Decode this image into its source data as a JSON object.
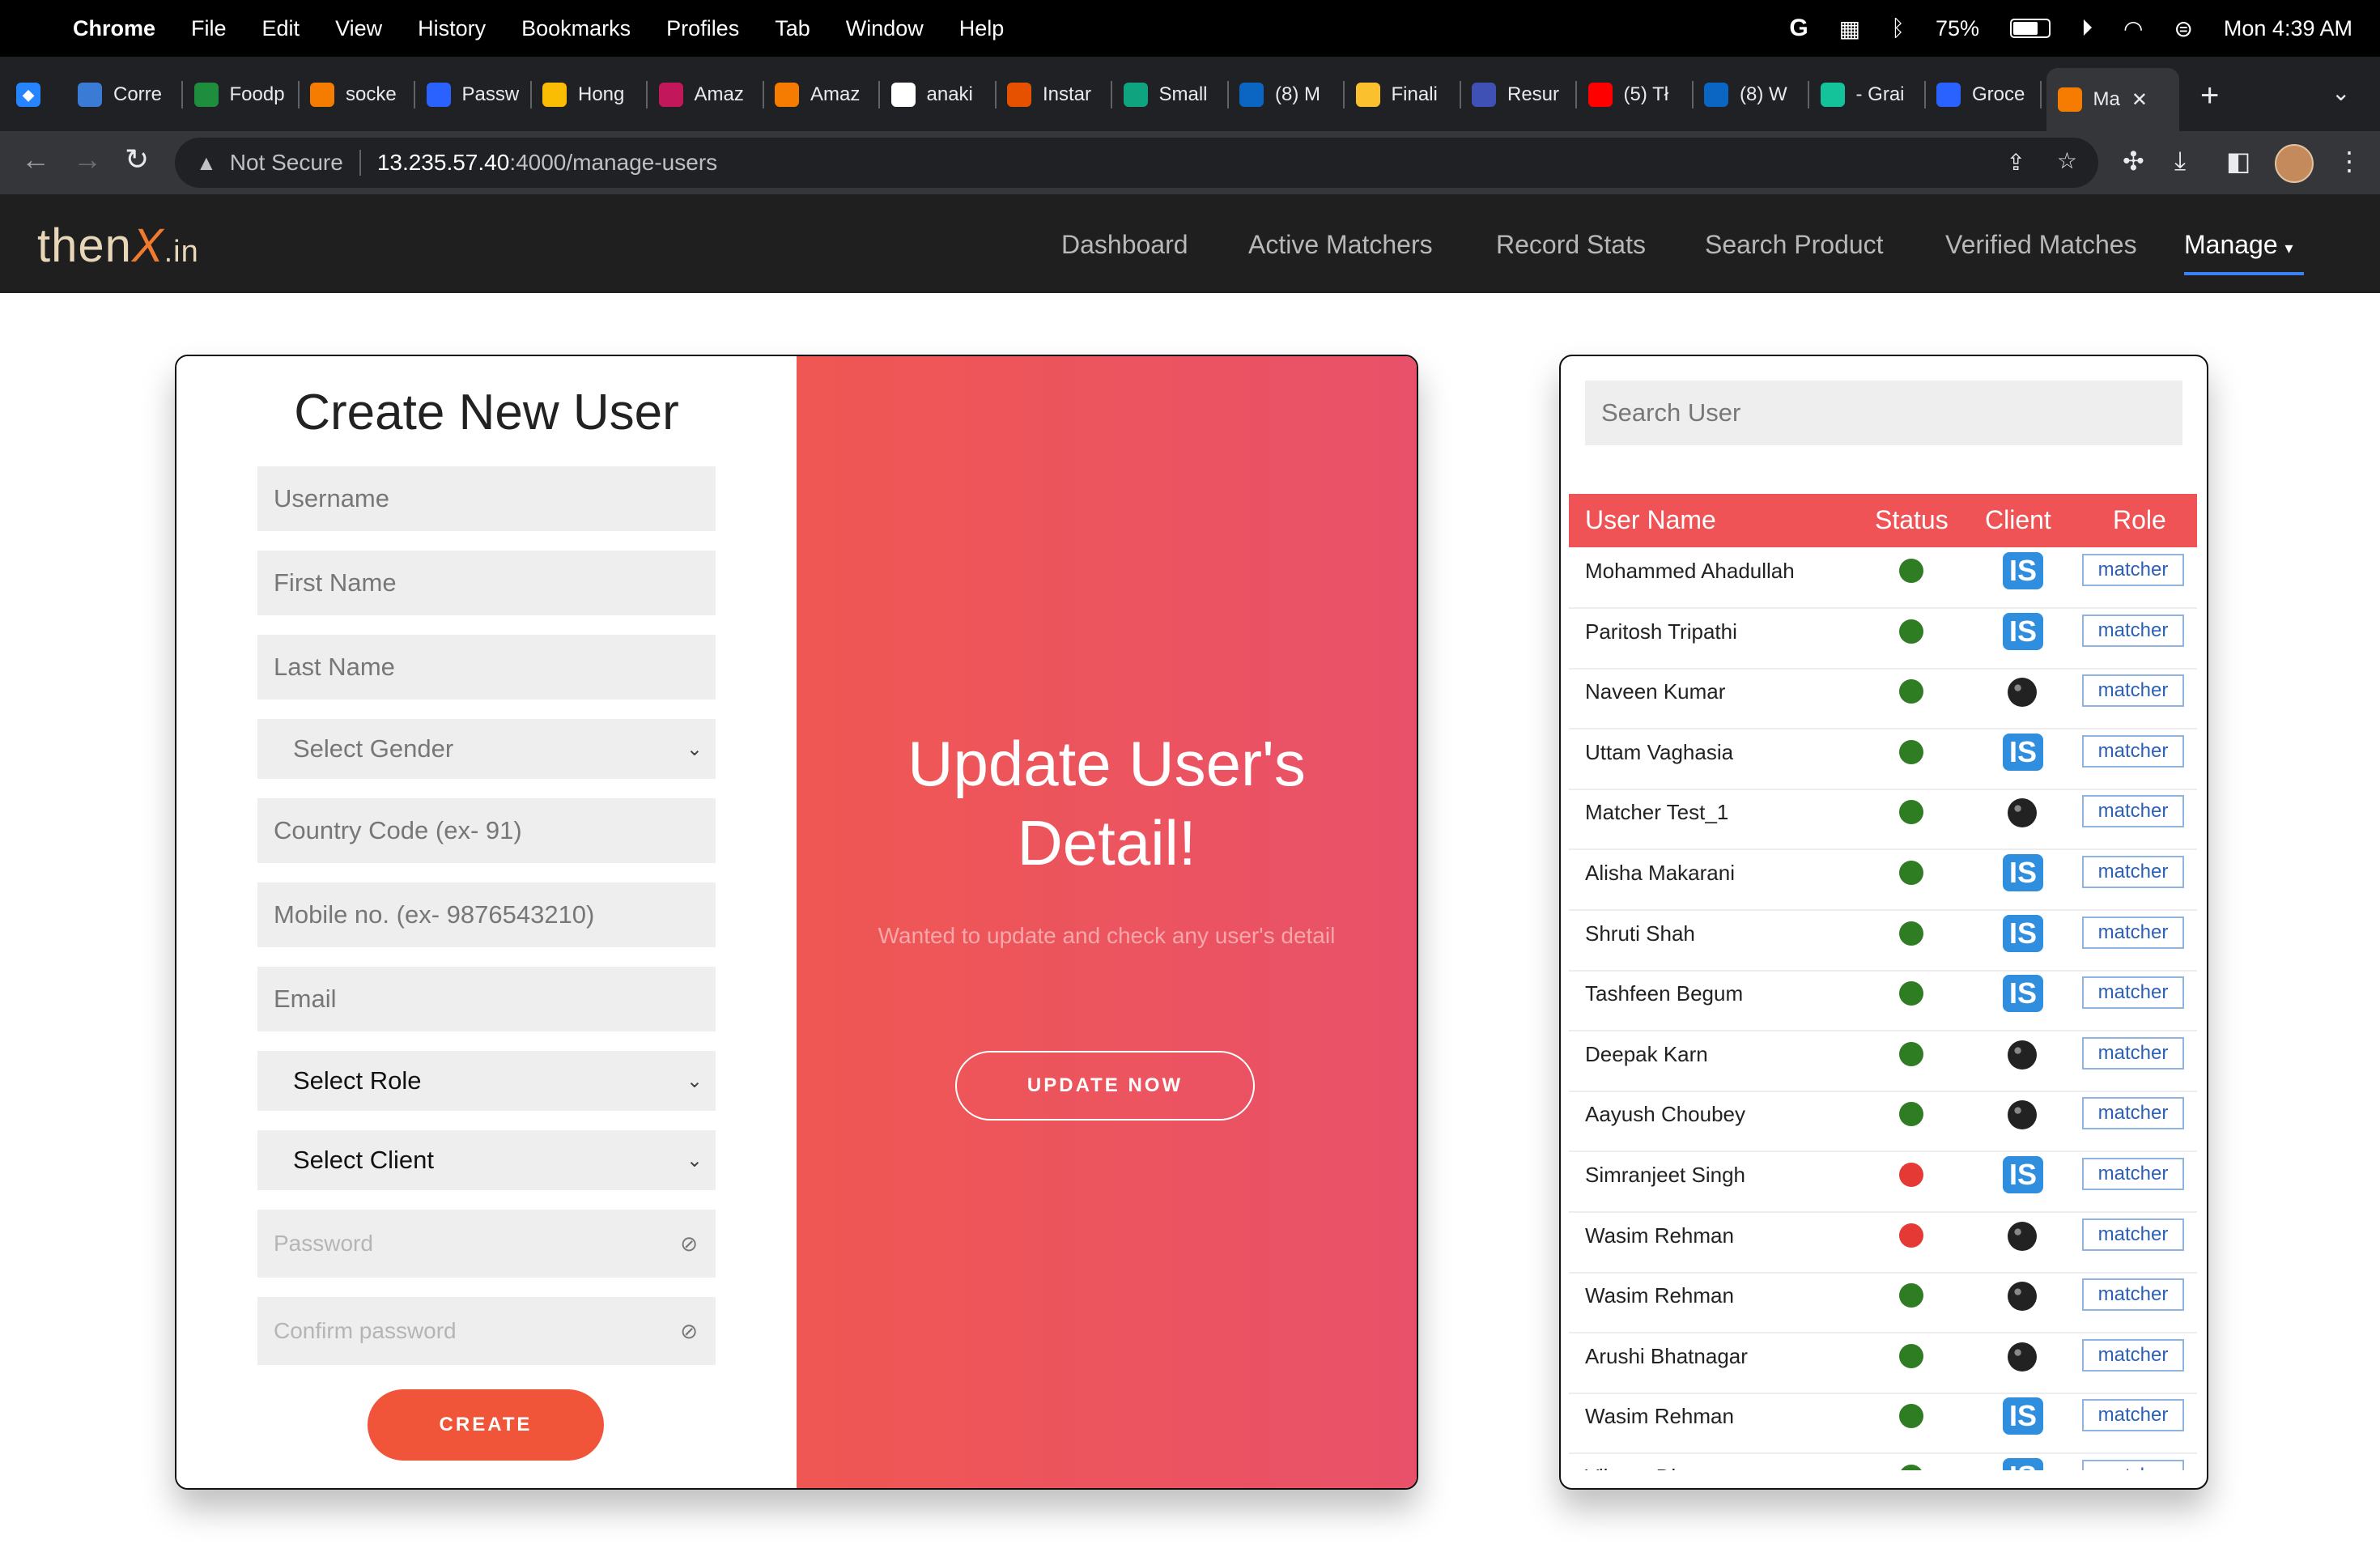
{
  "menubar": {
    "app": "Chrome",
    "items": [
      "File",
      "Edit",
      "View",
      "History",
      "Bookmarks",
      "Profiles",
      "Tab",
      "Window",
      "Help"
    ],
    "battery_percent": "75%",
    "clock": "Mon 4:39 AM"
  },
  "tabs": [
    {
      "label": "Corre",
      "color": "#3a7bd5"
    },
    {
      "label": "Foodp",
      "color": "#1e8e3e"
    },
    {
      "label": "socke",
      "color": "#f57c00"
    },
    {
      "label": "Passw",
      "color": "#2962ff"
    },
    {
      "label": "Hong",
      "color": "#fbbc04"
    },
    {
      "label": "Amaz",
      "color": "#c2185b"
    },
    {
      "label": "Amaz",
      "color": "#f57c00"
    },
    {
      "label": "anaki",
      "color": "#ffffff"
    },
    {
      "label": "Instar",
      "color": "#e65100"
    },
    {
      "label": "Small",
      "color": "#10a37f"
    },
    {
      "label": "(8) M",
      "color": "#0a66c2"
    },
    {
      "label": "Finali",
      "color": "#fbc02d"
    },
    {
      "label": "Resur",
      "color": "#3f51b5"
    },
    {
      "label": "(5) Tł",
      "color": "#ff0000"
    },
    {
      "label": "(8) W",
      "color": "#0a66c2"
    },
    {
      "label": "- Grai",
      "color": "#15c39a"
    },
    {
      "label": "Groce",
      "color": "#2962ff"
    },
    {
      "label": "Ma",
      "color": "#f57c00",
      "active": true
    }
  ],
  "address": {
    "security": "Not Secure",
    "host": "13.235.57.40",
    "path": ":4000/manage-users"
  },
  "site": {
    "logo": {
      "the": "then",
      "x": "X",
      "in": ".in"
    },
    "nav": [
      "Dashboard",
      "Active Matchers",
      "Record Stats",
      "Search Product",
      "Verified Matches"
    ],
    "manage": "Manage"
  },
  "form": {
    "title": "Create New User",
    "username": "Username",
    "first_name": "First Name",
    "last_name": "Last Name",
    "gender": "Select Gender",
    "country_code": "Country Code (ex- 91)",
    "mobile": "Mobile no. (ex- 9876543210)",
    "email": "Email",
    "role": "Select Role",
    "client": "Select Client",
    "password": "Password",
    "confirm_password": "Confirm password",
    "create": "CREATE"
  },
  "promo": {
    "title": "Update User's Detail!",
    "subtitle": "Wanted to update and check any user's detail",
    "button": "UPDATE NOW"
  },
  "users": {
    "search_placeholder": "Search User",
    "headers": {
      "name": "User Name",
      "status": "Status",
      "client": "Client",
      "role": "Role"
    },
    "status_colors": {
      "active": "#2e7d22",
      "inactive": "#e53935"
    },
    "rows": [
      {
        "name": "Mohammed Ahadullah",
        "status": "active",
        "client": "IS",
        "role": "matcher"
      },
      {
        "name": "Paritosh Tripathi",
        "status": "active",
        "client": "IS",
        "role": "matcher"
      },
      {
        "name": "Naveen Kumar",
        "status": "active",
        "client": "mark",
        "role": "matcher"
      },
      {
        "name": "Uttam Vaghasia",
        "status": "active",
        "client": "IS",
        "role": "matcher"
      },
      {
        "name": "Matcher Test_1",
        "status": "active",
        "client": "mark",
        "role": "matcher"
      },
      {
        "name": "Alisha Makarani",
        "status": "active",
        "client": "IS",
        "role": "matcher"
      },
      {
        "name": "Shruti Shah",
        "status": "active",
        "client": "IS",
        "role": "matcher"
      },
      {
        "name": "Tashfeen Begum",
        "status": "active",
        "client": "IS",
        "role": "matcher"
      },
      {
        "name": "Deepak Karn",
        "status": "active",
        "client": "mark",
        "role": "matcher"
      },
      {
        "name": "Aayush Choubey",
        "status": "active",
        "client": "mark",
        "role": "matcher"
      },
      {
        "name": "Simranjeet Singh",
        "status": "inactive",
        "client": "IS",
        "role": "matcher"
      },
      {
        "name": "Wasim Rehman",
        "status": "inactive",
        "client": "mark",
        "role": "matcher"
      },
      {
        "name": "Wasim Rehman",
        "status": "active",
        "client": "mark",
        "role": "matcher"
      },
      {
        "name": "Arushi Bhatnagar",
        "status": "active",
        "client": "mark",
        "role": "matcher"
      },
      {
        "name": "Wasim Rehman",
        "status": "active",
        "client": "IS",
        "role": "matcher"
      },
      {
        "name": "Vikram Dhar",
        "status": "active",
        "client": "IS",
        "role": "matcher"
      }
    ]
  }
}
